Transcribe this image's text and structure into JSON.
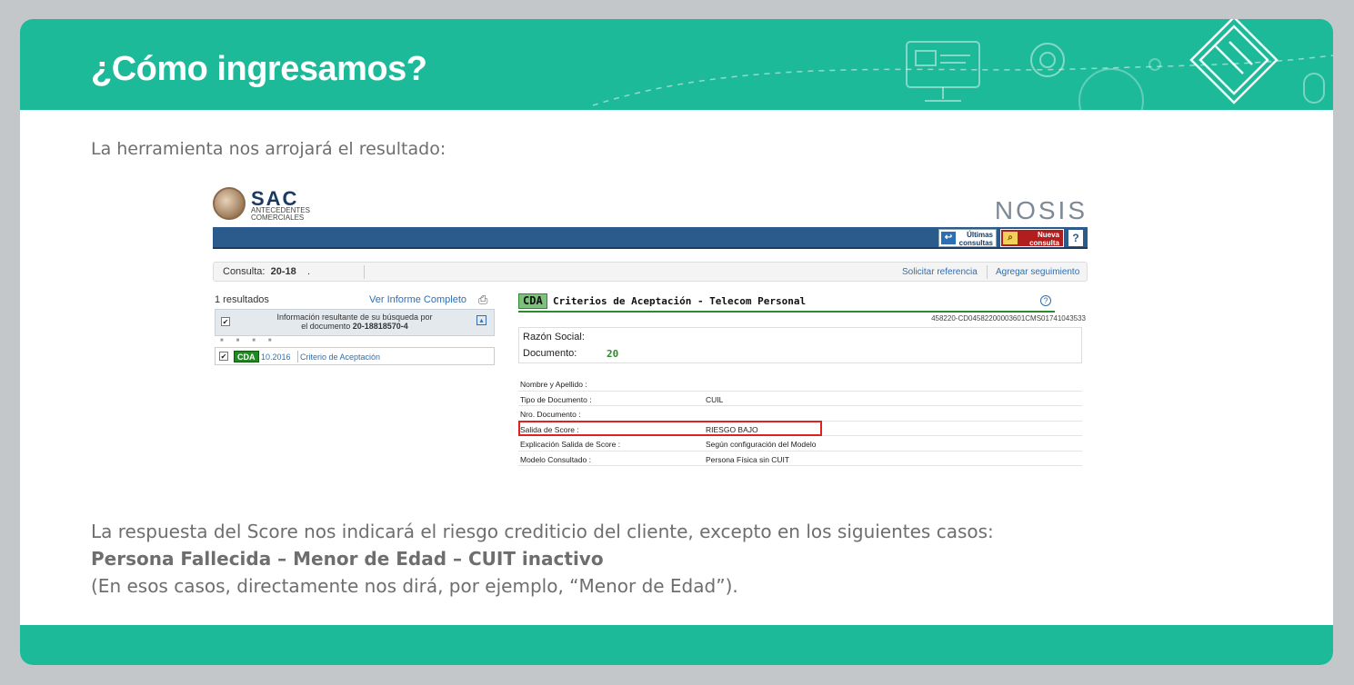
{
  "slide": {
    "title": "¿Cómo ingresamos?",
    "intro": "La herramienta nos arrojará el resultado:",
    "bottom_line1": "La respuesta del Score nos indicará el riesgo crediticio del cliente, excepto en los siguientes casos:",
    "bottom_line2": "Persona Fallecida – Menor de Edad – CUIT inactivo",
    "bottom_line3": "(En esos casos, directamente nos dirá, por ejemplo, “Menor de Edad”).",
    "colors": {
      "header": "#1dba99",
      "text": "#6e6e6e"
    },
    "header_icons": [
      "presentation-icon",
      "gear-icon",
      "magnifier-icon",
      "puzzle-icon",
      "mouse-icon"
    ]
  },
  "app": {
    "brand_title": "SAC",
    "brand_sub1": "ANTECEDENTES",
    "brand_sub2": "COMERCIALES",
    "vendor": "NOSIS",
    "toolbar": {
      "ultimas_line1": "Últimas",
      "ultimas_line2": "consultas",
      "nueva_line1": "Nueva",
      "nueva_line2": "consulta",
      "help": "?"
    },
    "consulta": {
      "label": "Consulta:",
      "value": "20-18",
      "dot": ".",
      "solicitar": "Solicitar referencia",
      "agregar": "Agregar seguimiento"
    },
    "results": {
      "count": "1 resultados",
      "ver_informe": "Ver Informe Completo",
      "info_line1": "Información resultante de su búsqueda por",
      "info_line2_prefix": "el documento",
      "info_line2_doc": "20-18818570-4",
      "row": {
        "badge": "CDA",
        "date": "10.2016",
        "label": "Criterio de Aceptación"
      }
    },
    "report": {
      "badge": "CDA",
      "title": "Criterios de Aceptación - Telecom Personal",
      "code": "458220-CD04582200003601CMS01741043533",
      "razon_social_label": "Razón Social:",
      "documento_label": "Documento:",
      "documento_value": "20",
      "rows": [
        {
          "key": "Nombre y Apellido :",
          "value": ""
        },
        {
          "key": "Tipo de Documento :",
          "value": "CUIL"
        },
        {
          "key": "Nro. Documento :",
          "value": ""
        },
        {
          "key": "Salida de Score :",
          "value": "RIESGO BAJO"
        },
        {
          "key": "Explicación Salida de Score :",
          "value": "Según configuración del Modelo"
        },
        {
          "key": "Modelo Consultado :",
          "value": "Persona Física sin CUIT"
        }
      ]
    }
  }
}
